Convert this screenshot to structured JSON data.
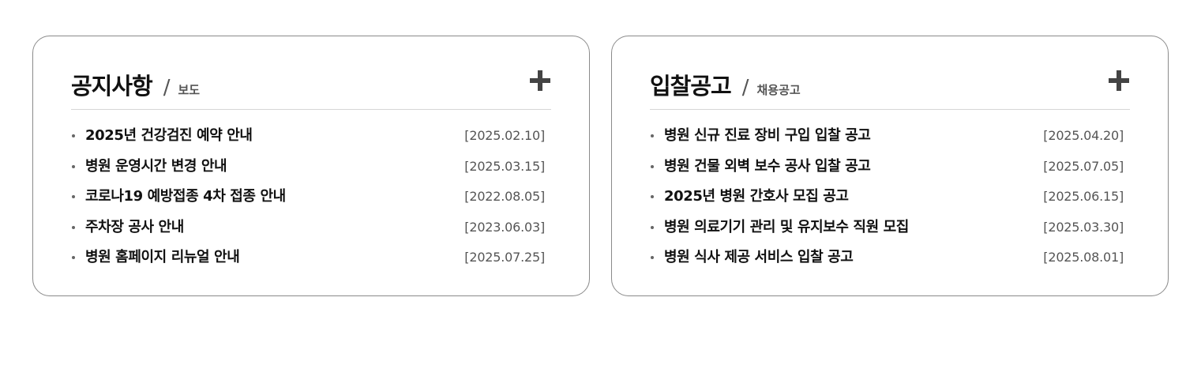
{
  "notice": {
    "title": "공지사항",
    "separator": "/",
    "subtitle": "보도",
    "more_icon": "plus-icon",
    "items": [
      {
        "title": "2025년 건강검진 예약 안내",
        "date": "[2025.02.10]"
      },
      {
        "title": "병원 운영시간 변경 안내",
        "date": "[2025.03.15]"
      },
      {
        "title": "코로나19 예방접종 4차 접종 안내",
        "date": "[2022.08.05]"
      },
      {
        "title": "주차장 공사 안내",
        "date": "[2023.06.03]"
      },
      {
        "title": "병원 홈페이지 리뉴얼 안내",
        "date": "[2025.07.25]"
      }
    ]
  },
  "bid": {
    "title": "입찰공고",
    "separator": "/",
    "subtitle": "채용공고",
    "more_icon": "plus-icon",
    "items": [
      {
        "title": "병원 신규 진료 장비 구입 입찰 공고",
        "date": "[2025.04.20]"
      },
      {
        "title": "병원 건물 외벽 보수 공사 입찰 공고",
        "date": "[2025.07.05]"
      },
      {
        "title": "2025년 병원 간호사 모집 공고",
        "date": "[2025.06.15]"
      },
      {
        "title": "병원 의료기기 관리 및 유지보수 직원 모집",
        "date": "[2025.03.30]"
      },
      {
        "title": "병원 식사 제공 서비스 입찰 공고",
        "date": "[2025.08.01]"
      }
    ]
  },
  "colors": {
    "border": "#8a8a8a",
    "divider": "#d6d6d6",
    "text": "#111111",
    "muted": "#555555",
    "icon": "#444444"
  }
}
